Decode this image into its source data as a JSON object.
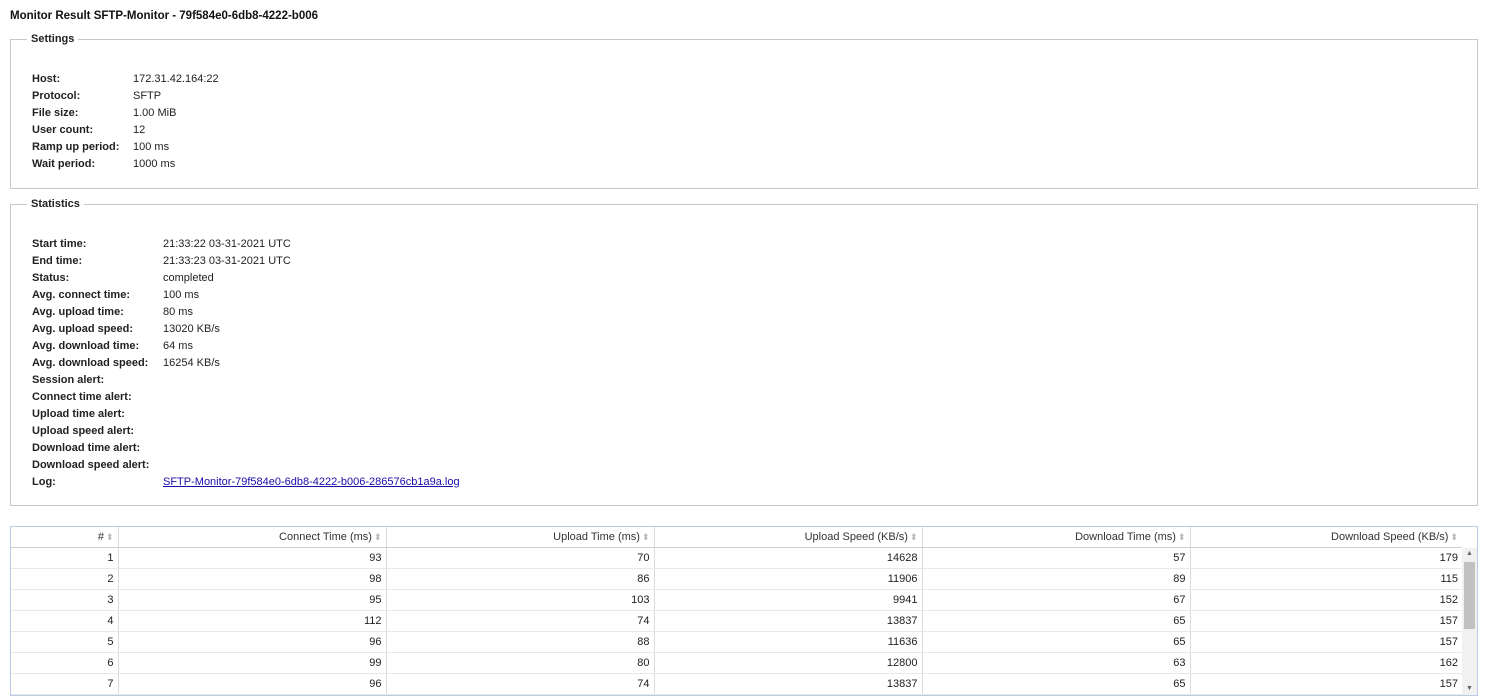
{
  "page": {
    "title": "Monitor Result SFTP-Monitor - 79f584e0-6db8-4222-b006"
  },
  "settings": {
    "legend": "Settings",
    "rows": [
      {
        "label": "Host:",
        "value": "172.31.42.164:22"
      },
      {
        "label": "Protocol:",
        "value": "SFTP"
      },
      {
        "label": "File size:",
        "value": "1.00 MiB"
      },
      {
        "label": "User count:",
        "value": "12"
      },
      {
        "label": "Ramp up period:",
        "value": "100 ms"
      },
      {
        "label": "Wait period:",
        "value": "1000 ms"
      }
    ]
  },
  "statistics": {
    "legend": "Statistics",
    "rows": [
      {
        "label": "Start time:",
        "value": "21:33:22 03-31-2021 UTC"
      },
      {
        "label": "End time:",
        "value": "21:33:23 03-31-2021 UTC"
      },
      {
        "label": "Status:",
        "value": "completed"
      },
      {
        "label": "Avg. connect time:",
        "value": "100 ms"
      },
      {
        "label": "Avg. upload time:",
        "value": "80 ms"
      },
      {
        "label": "Avg. upload speed:",
        "value": "13020 KB/s"
      },
      {
        "label": "Avg. download time:",
        "value": "64 ms"
      },
      {
        "label": "Avg. download speed:",
        "value": "16254 KB/s"
      },
      {
        "label": "Session alert:",
        "value": ""
      },
      {
        "label": "Connect time alert:",
        "value": ""
      },
      {
        "label": "Upload time alert:",
        "value": ""
      },
      {
        "label": "Upload speed alert:",
        "value": ""
      },
      {
        "label": "Download time alert:",
        "value": ""
      },
      {
        "label": "Download speed alert:",
        "value": ""
      }
    ],
    "log": {
      "label": "Log:",
      "link_text": "SFTP-Monitor-79f584e0-6db8-4222-b006-286576cb1a9a.log"
    }
  },
  "results_table": {
    "columns": [
      "#",
      "Connect Time (ms)",
      "Upload Time (ms)",
      "Upload Speed (KB/s)",
      "Download Time (ms)",
      "Download Speed (KB/s)"
    ],
    "sort_icon": "sort-arrows-icon",
    "rows": [
      [
        "1",
        "93",
        "70",
        "14628",
        "57",
        "179"
      ],
      [
        "2",
        "98",
        "86",
        "11906",
        "89",
        "115"
      ],
      [
        "3",
        "95",
        "103",
        "9941",
        "67",
        "152"
      ],
      [
        "4",
        "112",
        "74",
        "13837",
        "65",
        "157"
      ],
      [
        "5",
        "96",
        "88",
        "11636",
        "65",
        "157"
      ],
      [
        "6",
        "99",
        "80",
        "12800",
        "63",
        "162"
      ],
      [
        "7",
        "96",
        "74",
        "13837",
        "65",
        "157"
      ]
    ]
  }
}
